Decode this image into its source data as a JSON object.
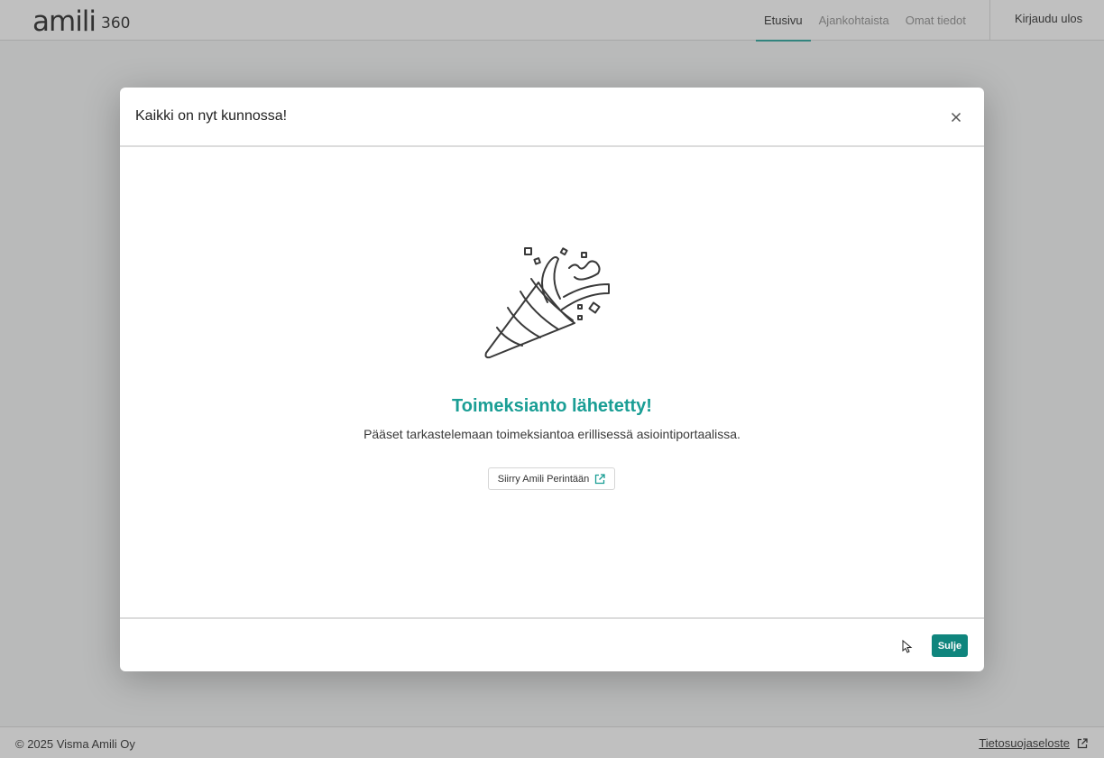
{
  "header": {
    "logo_word": "amili",
    "logo_num": "360",
    "nav": [
      {
        "label": "Etusivu",
        "active": true
      },
      {
        "label": "Ajankohtaista",
        "active": false
      },
      {
        "label": "Omat tiedot",
        "active": false
      }
    ],
    "logout_label": "Kirjaudu ulos"
  },
  "modal": {
    "title": "Kaikki on nyt kunnossa!",
    "close_icon": "close-icon",
    "illustration_icon": "party-popper-icon",
    "success_title": "Toimeksianto lähetetty!",
    "success_text": "Pääset tarkastelemaan toimeksiantoa erillisessä asiointiportaalissa.",
    "portal_button_label": "Siirry Amili Perintään",
    "portal_button_icon": "external-link-icon",
    "close_button_label": "Sulje"
  },
  "footer": {
    "copyright": "© 2025 Visma Amili Oy",
    "privacy_label": "Tietosuojaseloste",
    "privacy_icon": "external-link-icon"
  },
  "colors": {
    "accent": "#1a9e95",
    "button_primary": "#0f857d",
    "overlay": "rgba(90,90,90,0.38)"
  }
}
